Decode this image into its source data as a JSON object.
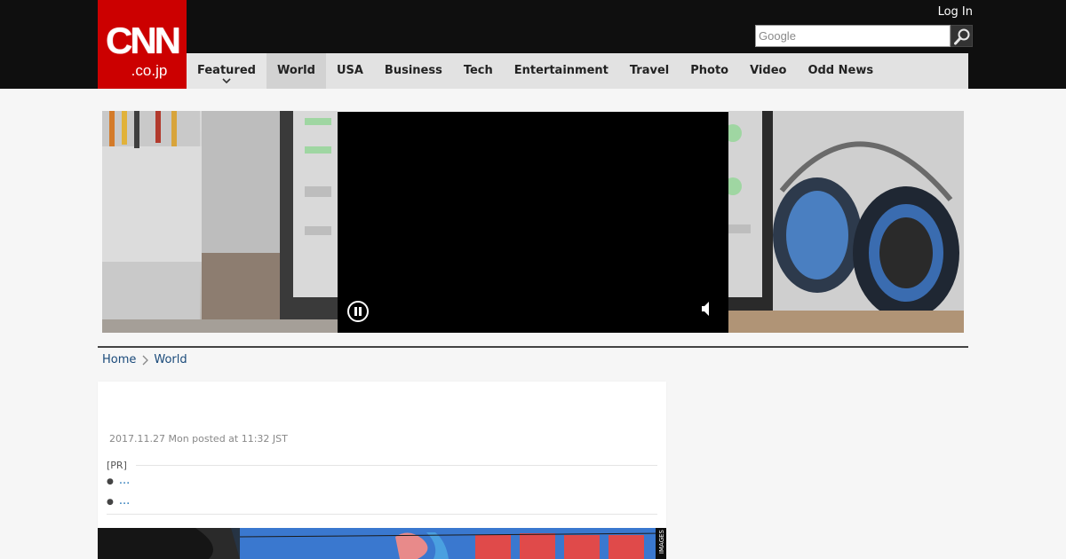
{
  "header": {
    "logo_text": "CNN",
    "logo_sub": ".co.jp",
    "login_label": "Log In",
    "search_placeholder": "Google"
  },
  "nav": {
    "items": [
      {
        "label": "Featured"
      },
      {
        "label": "World"
      },
      {
        "label": "USA"
      },
      {
        "label": "Business"
      },
      {
        "label": "Tech"
      },
      {
        "label": "Entertainment"
      },
      {
        "label": "Travel"
      },
      {
        "label": "Photo"
      },
      {
        "label": "Video"
      },
      {
        "label": "Odd News"
      }
    ],
    "active": "World"
  },
  "video": {
    "state": "playing",
    "muted": true,
    "icons": [
      "pause-icon",
      "speaker-muted-icon"
    ]
  },
  "breadcrumb": {
    "home": "Home",
    "current": "World"
  },
  "article": {
    "posted": "2017.11.27 Mon posted at 11:32 JST",
    "pr_label": "[PR]",
    "pr_links": [
      "...",
      "..."
    ]
  },
  "photo_caption": "IMAGES",
  "colors": {
    "brand_red": "#cc0000",
    "topbar": "#0f0f0f",
    "nav_bg": "#e2e2e2",
    "link": "#1a6fb3"
  }
}
